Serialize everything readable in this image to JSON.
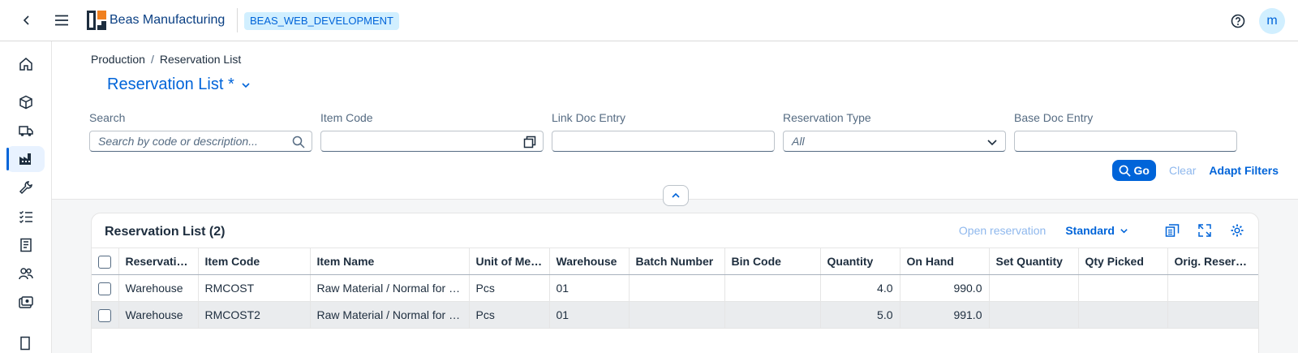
{
  "shell": {
    "brand": "Beas Manufacturing",
    "environment": "BEAS_WEB_DEVELOPMENT",
    "avatar_initial": "m"
  },
  "sidenav": {
    "items": [
      {
        "icon": "home-icon"
      },
      {
        "icon": "cube-icon"
      },
      {
        "icon": "truck-icon"
      },
      {
        "icon": "factory-icon",
        "active": true
      },
      {
        "icon": "wrench-icon"
      },
      {
        "icon": "checklist-icon"
      },
      {
        "icon": "document-icon"
      },
      {
        "icon": "people-icon"
      },
      {
        "icon": "money-icon"
      }
    ]
  },
  "breadcrumb": {
    "parent": "Production",
    "separator": "/",
    "current": "Reservation List"
  },
  "page": {
    "title": "Reservation List *"
  },
  "filters": {
    "search": {
      "label": "Search",
      "placeholder": "Search by code or description..."
    },
    "item_code": {
      "label": "Item Code",
      "value": ""
    },
    "link_doc_entry": {
      "label": "Link Doc Entry",
      "value": ""
    },
    "reservation_type": {
      "label": "Reservation Type",
      "value": "All"
    },
    "base_doc_entry": {
      "label": "Base Doc Entry",
      "value": ""
    }
  },
  "actions": {
    "go": "Go",
    "clear": "Clear",
    "adapt": "Adapt Filters"
  },
  "table": {
    "title": "Reservation List (2)",
    "open_reservation": "Open reservation",
    "variant": "Standard",
    "columns": [
      "Reservation Type",
      "Item Code",
      "Item Name",
      "Unit of Measure",
      "Warehouse",
      "Batch Number",
      "Bin Code",
      "Quantity",
      "On Hand",
      "Set Quantity",
      "Qty Picked",
      "Orig. Reserved"
    ],
    "rows": [
      {
        "type": "Warehouse",
        "item_code": "RMCOST",
        "item_name": "Raw Material / Normal for Costing",
        "uom": "Pcs",
        "warehouse": "01",
        "batch": "",
        "bin": "",
        "quantity": "4.0",
        "on_hand": "990.0",
        "set_qty": "",
        "qty_picked": "",
        "orig_reserved": ""
      },
      {
        "type": "Warehouse",
        "item_code": "RMCOST2",
        "item_name": "Raw Material / Normal for Costing",
        "uom": "Pcs",
        "warehouse": "01",
        "batch": "",
        "bin": "",
        "quantity": "5.0",
        "on_hand": "991.0",
        "set_qty": "",
        "qty_picked": "",
        "orig_reserved": ""
      }
    ]
  }
}
